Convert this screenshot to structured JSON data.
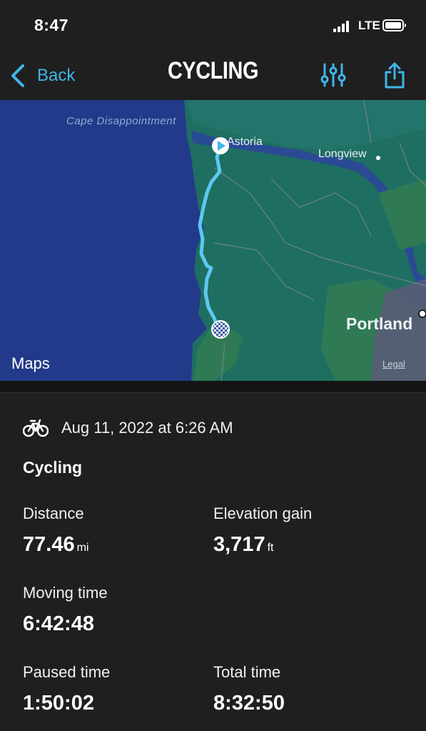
{
  "status_bar": {
    "time": "8:47",
    "network": "LTE"
  },
  "nav": {
    "back_label": "Back",
    "title": "CYCLING",
    "filter_icon": "sliders-icon",
    "share_icon": "share-icon"
  },
  "map": {
    "labels": {
      "cape": "Cape Disappointment",
      "astoria": "Astoria",
      "longview": "Longview",
      "portland": "Portland",
      "maps": "Maps",
      "legal": "Legal"
    },
    "colors": {
      "ocean": "#233a8a",
      "land": "#1f6e62",
      "route": "#5cc8ef",
      "forest": "#2f7a55",
      "urban": "#5a5a7a"
    }
  },
  "activity": {
    "date": "Aug 11, 2022 at 6:26 AM",
    "type": "Cycling",
    "stats": {
      "distance": {
        "label": "Distance",
        "value": "77.46",
        "unit": "mi"
      },
      "elevation": {
        "label": "Elevation gain",
        "value": "3,717",
        "unit": "ft"
      },
      "moving": {
        "label": "Moving time",
        "value": "6:42:48"
      },
      "paused": {
        "label": "Paused time",
        "value": "1:50:02"
      },
      "total": {
        "label": "Total time",
        "value": "8:32:50"
      }
    }
  }
}
